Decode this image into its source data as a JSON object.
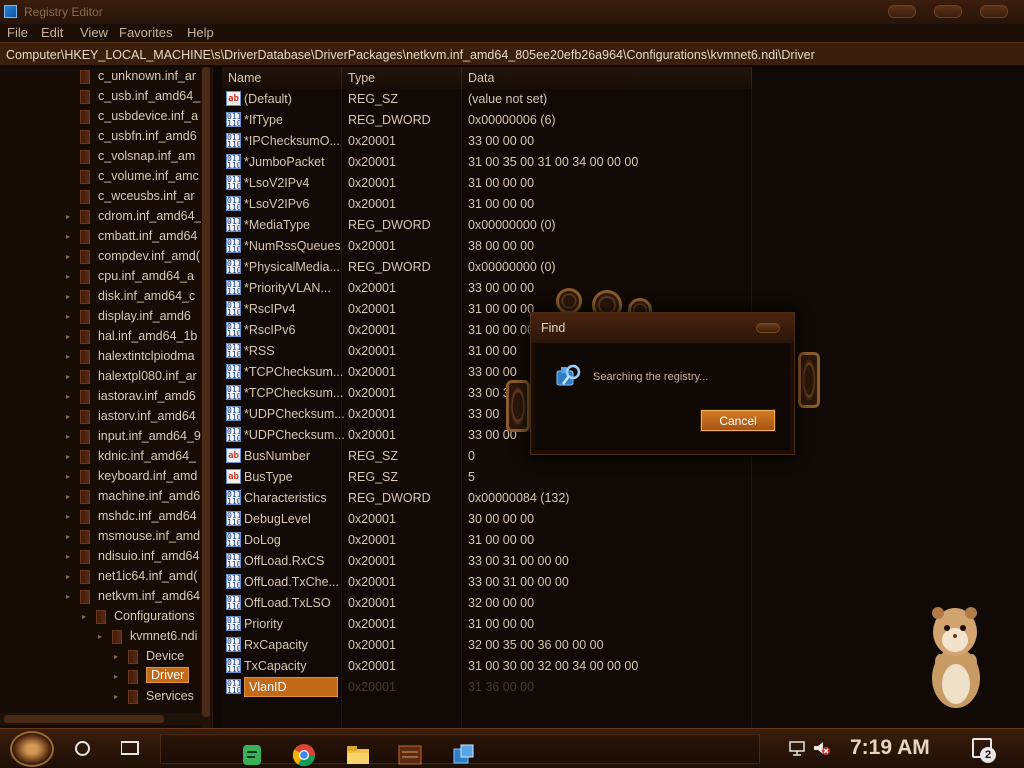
{
  "window": {
    "title": "Registry Editor",
    "app_icon": "registry-icon"
  },
  "menu": [
    "File",
    "Edit",
    "View",
    "Favorites",
    "Help"
  ],
  "address": "Computer\\HKEY_LOCAL_MACHINE\\s\\DriverDatabase\\DriverPackages\\netkvm.inf_amd64_805ee20efb26a964\\Configurations\\kvmnet6.ndi\\Driver",
  "tree": {
    "items": [
      {
        "label": "c_unknown.inf_ar"
      },
      {
        "label": "c_usb.inf_amd64_"
      },
      {
        "label": "c_usbdevice.inf_a"
      },
      {
        "label": "c_usbfn.inf_amd6"
      },
      {
        "label": "c_volsnap.inf_am"
      },
      {
        "label": "c_volume.inf_amc"
      },
      {
        "label": "c_wceusbs.inf_ar"
      },
      {
        "label": "cdrom.inf_amd64_"
      },
      {
        "label": "cmbatt.inf_amd64"
      },
      {
        "label": "compdev.inf_amd("
      },
      {
        "label": "cpu.inf_amd64_a"
      },
      {
        "label": "disk.inf_amd64_c"
      },
      {
        "label": "display.inf_amd6"
      },
      {
        "label": "hal.inf_amd64_1b"
      },
      {
        "label": "halextintclpiodma"
      },
      {
        "label": "halextpl080.inf_ar"
      },
      {
        "label": "iastorav.inf_amd6"
      },
      {
        "label": "iastorv.inf_amd64"
      },
      {
        "label": "input.inf_amd64_9"
      },
      {
        "label": "kdnic.inf_amd64_"
      },
      {
        "label": "keyboard.inf_amd"
      },
      {
        "label": "machine.inf_amd6"
      },
      {
        "label": "mshdc.inf_amd64"
      },
      {
        "label": "msmouse.inf_amd"
      },
      {
        "label": "ndisuio.inf_amd64"
      },
      {
        "label": "net1ic64.inf_amd("
      },
      {
        "label": "netkvm.inf_amd64"
      },
      {
        "label": "Configurations"
      },
      {
        "label": "kvmnet6.ndi"
      },
      {
        "label": "Device"
      },
      {
        "label": "Driver"
      },
      {
        "label": "Services"
      }
    ]
  },
  "list": {
    "columns": [
      "Name",
      "Type",
      "Data"
    ],
    "rows": [
      {
        "icon": "ab",
        "name": "(Default)",
        "type": "REG_SZ",
        "data": "(value not set)"
      },
      {
        "icon": "bin",
        "name": "*IfType",
        "type": "REG_DWORD",
        "data": "0x00000006 (6)"
      },
      {
        "icon": "bin",
        "name": "*IPChecksumO...",
        "type": "0x20001",
        "data": "33 00 00 00"
      },
      {
        "icon": "bin",
        "name": "*JumboPacket",
        "type": "0x20001",
        "data": "31 00 35 00 31 00 34 00 00 00"
      },
      {
        "icon": "bin",
        "name": "*LsoV2IPv4",
        "type": "0x20001",
        "data": "31 00 00 00"
      },
      {
        "icon": "bin",
        "name": "*LsoV2IPv6",
        "type": "0x20001",
        "data": "31 00 00 00"
      },
      {
        "icon": "bin",
        "name": "*MediaType",
        "type": "REG_DWORD",
        "data": "0x00000000 (0)"
      },
      {
        "icon": "bin",
        "name": "*NumRssQueues",
        "type": "0x20001",
        "data": "38 00 00 00"
      },
      {
        "icon": "bin",
        "name": "*PhysicalMedia...",
        "type": "REG_DWORD",
        "data": "0x00000000 (0)"
      },
      {
        "icon": "bin",
        "name": "*PriorityVLAN...",
        "type": "0x20001",
        "data": "33 00 00 00"
      },
      {
        "icon": "bin",
        "name": "*RscIPv4",
        "type": "0x20001",
        "data": "31 00 00 00"
      },
      {
        "icon": "bin",
        "name": "*RscIPv6",
        "type": "0x20001",
        "data": "31 00 00 00"
      },
      {
        "icon": "bin",
        "name": "*RSS",
        "type": "0x20001",
        "data": "31 00 00"
      },
      {
        "icon": "bin",
        "name": "*TCPChecksum...",
        "type": "0x20001",
        "data": "33 00 00"
      },
      {
        "icon": "bin",
        "name": "*TCPChecksum...",
        "type": "0x20001",
        "data": "33 00 30"
      },
      {
        "icon": "bin",
        "name": "*UDPChecksum...",
        "type": "0x20001",
        "data": "33 00"
      },
      {
        "icon": "bin",
        "name": "*UDPChecksum...",
        "type": "0x20001",
        "data": "33 00 00"
      },
      {
        "icon": "ab",
        "name": "BusNumber",
        "type": "REG_SZ",
        "data": "0"
      },
      {
        "icon": "ab",
        "name": "BusType",
        "type": "REG_SZ",
        "data": "5"
      },
      {
        "icon": "bin",
        "name": "Characteristics",
        "type": "REG_DWORD",
        "data": "0x00000084 (132)"
      },
      {
        "icon": "bin",
        "name": "DebugLevel",
        "type": "0x20001",
        "data": "30 00 00 00"
      },
      {
        "icon": "bin",
        "name": "DoLog",
        "type": "0x20001",
        "data": "31 00 00 00"
      },
      {
        "icon": "bin",
        "name": "OffLoad.RxCS",
        "type": "0x20001",
        "data": "33 00 31 00 00 00"
      },
      {
        "icon": "bin",
        "name": "OffLoad.TxChe...",
        "type": "0x20001",
        "data": "33 00 31 00 00 00"
      },
      {
        "icon": "bin",
        "name": "OffLoad.TxLSO",
        "type": "0x20001",
        "data": "32 00 00 00"
      },
      {
        "icon": "bin",
        "name": "Priority",
        "type": "0x20001",
        "data": "31 00 00 00"
      },
      {
        "icon": "bin",
        "name": "RxCapacity",
        "type": "0x20001",
        "data": "32 00 35 00 36 00 00 00"
      },
      {
        "icon": "bin",
        "name": "TxCapacity",
        "type": "0x20001",
        "data": "31 00 30 00 32 00 34 00 00 00"
      },
      {
        "icon": "bin",
        "name": "VlanID",
        "type": "0x20001",
        "data": "31 36 00 00"
      }
    ]
  },
  "find_dialog": {
    "title": "Find",
    "message": "Searching the registry...",
    "cancel_label": "Cancel"
  },
  "taskbar": {
    "clock": "7:19 AM",
    "notification_count": "2",
    "apps": [
      "notes-app-icon",
      "chrome-icon",
      "file-explorer-icon",
      "media-app-icon",
      "registry-editor-icon"
    ]
  },
  "colors": {
    "accent": "#c2691a",
    "background": "#100905",
    "text": "#d6c7b1"
  }
}
